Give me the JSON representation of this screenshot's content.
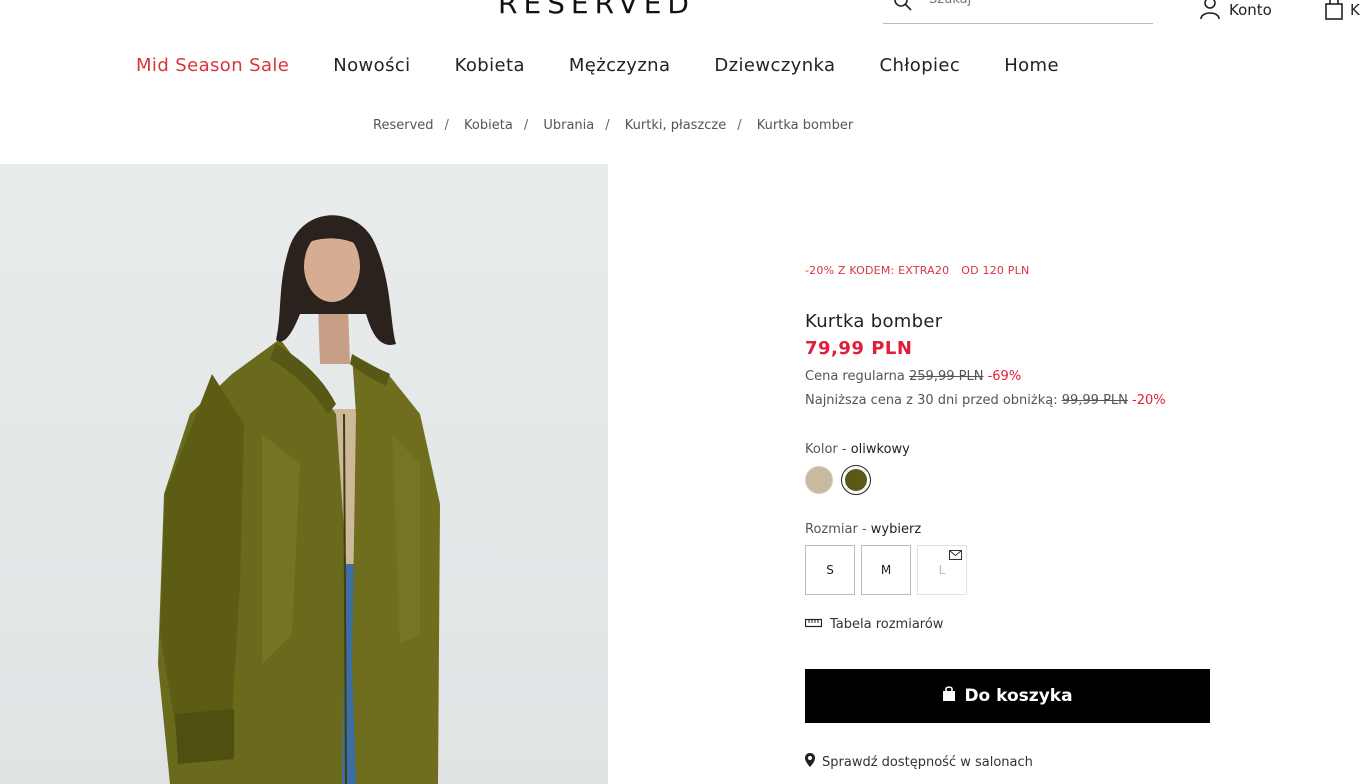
{
  "header": {
    "logo": "RESERVED",
    "search_placeholder": "Szukaj",
    "account_label": "Konto",
    "cart_label": "K"
  },
  "nav": {
    "items": [
      "Mid Season Sale",
      "Nowości",
      "Kobieta",
      "Mężczyzna",
      "Dziewczynka",
      "Chłopiec",
      "Home"
    ]
  },
  "breadcrumb": [
    "Reserved",
    "Kobieta",
    "Ubrania",
    "Kurtki, płaszcze",
    "Kurtka bomber"
  ],
  "product": {
    "promo_code": "-20% Z KODEM: EXTRA20",
    "promo_min": "OD 120 PLN",
    "name": "Kurtka bomber",
    "price": "79,99 PLN",
    "regular_label": "Cena regularna",
    "regular_price": "259,99 PLN",
    "regular_discount": "-69%",
    "lowest_label": "Najniższa cena z 30 dni przed obniżką:",
    "lowest_price": "99,99 PLN",
    "lowest_discount": "-20%",
    "color_label": "Kolor -",
    "color_value": "oliwkowy",
    "colors": [
      "#c9b9a3",
      "#5e5817"
    ],
    "size_label": "Rozmiar -",
    "size_value": "wybierz",
    "sizes": [
      "S",
      "M",
      "L"
    ],
    "size_table": "Tabela rozmiarów",
    "add_to_cart": "Do koszyka",
    "availability": "Sprawdź dostępność w salonach"
  },
  "colors": {
    "sale": "#d9343d",
    "price": "#e11d3a",
    "button": "#000000"
  }
}
